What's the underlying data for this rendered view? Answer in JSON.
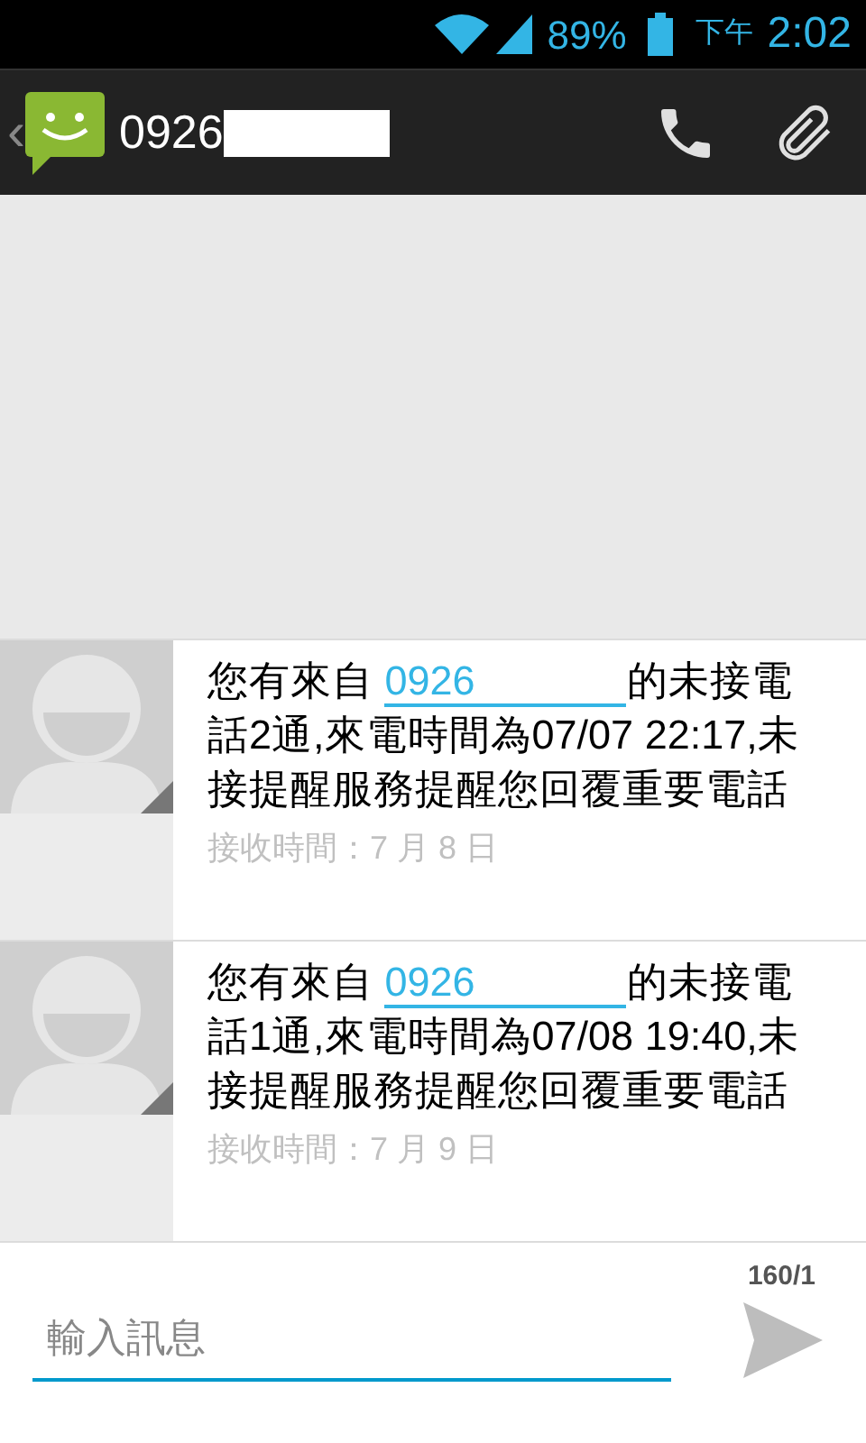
{
  "status_bar": {
    "battery": "89%",
    "period": "下午",
    "time": "2:02"
  },
  "action_bar": {
    "back": "‹",
    "contact": "0926"
  },
  "messages": [
    {
      "prefix": "您有來自 ",
      "link": "0926",
      "suffix": "的未接電話2通,來電時間為07/07 22:17,未接提醒服務提醒您回覆重要電話",
      "received": "接收時間：7 月 8 日"
    },
    {
      "prefix": "您有來自 ",
      "link": "0926",
      "suffix": "的未接電話1通,來電時間為07/08 19:40,未接提醒服務提醒您回覆重要電話",
      "received": "接收時間：7 月 9 日"
    }
  ],
  "composer": {
    "counter": "160/1",
    "placeholder": "輸入訊息"
  }
}
